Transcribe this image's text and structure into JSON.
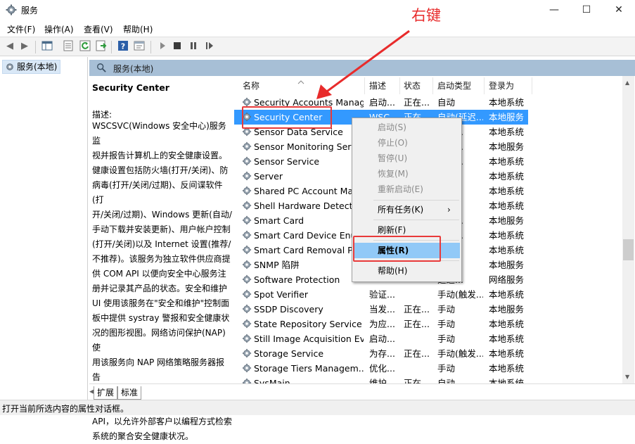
{
  "window": {
    "title": "服务",
    "buttons": {
      "minimize": "—",
      "maximize": "☐",
      "close": "✕"
    }
  },
  "menu": [
    "文件(F)",
    "操作(A)",
    "查看(V)",
    "帮助(H)"
  ],
  "tree": {
    "root": "服务(本地)"
  },
  "pane_header": "服务(本地)",
  "description": {
    "title": "Security Center",
    "label": "描述:",
    "text": "WSCSVC(Windows 安全中心)服务监视并报告计算机上的安全健康设置。健康设置包括防火墙(打开/关闭)、防病毒(打开/关闭/过期)、反间谍软件(打开/关闭/过期)、Windows 更新(自动/手动下载并安装更新)、用户帐户控制(打开/关闭)以及 Internet 设置(推荐/不推荐)。该服务为独立软件供应商提供 COM API 以便向安全中心服务注册并记录其产品的状态。安全和维护 UI 使用该服务在\"安全和维护\"控制面板中提供 systray 警报和安全健康状况的图形视图。网络访问保护(NAP)使用该服务向 NAP 网络策略服务器报告客户端的安全健康状况，以便进行网络隔离决策。该服务还提供一个公共 API，以允许外部客户以编程方式检索系统的聚合安全健康状况。",
    "lines": [
      "WSCSVC(Windows 安全中心)服务监",
      "视并报告计算机上的安全健康设置。",
      "健康设置包括防火墙(打开/关闭)、防",
      "病毒(打开/关闭/过期)、反间谍软件(打",
      "开/关闭/过期)、Windows 更新(自动/",
      "手动下载并安装更新)、用户帐户控制",
      "(打开/关闭)以及 Internet 设置(推荐/",
      "不推荐)。该服务为独立软件供应商提",
      "供 COM API 以便向安全中心服务注",
      "册并记录其产品的状态。安全和维护",
      "UI 使用该服务在\"安全和维护\"控制面",
      "板中提供 systray 警报和安全健康状",
      "况的图形视图。网络访问保护(NAP)使",
      "用该服务向 NAP 网络策略服务器报告",
      "客户端的安全健康状况，以便进行网",
      "络隔离决策。该服务还提供一个公共",
      "API，以允许外部客户以编程方式检索",
      "系统的聚合安全健康状况。"
    ]
  },
  "columns": [
    "名称",
    "描述",
    "状态",
    "启动类型",
    "登录为"
  ],
  "rows": [
    {
      "name": "Security Accounts Manag...",
      "desc": "启动...",
      "status": "正在...",
      "startup": "自动",
      "logon": "本地系统"
    },
    {
      "name": "Security Center",
      "desc": "WSC...",
      "status": "正在...",
      "startup": "自动(延迟...",
      "logon": "本地服务"
    },
    {
      "name": "Sensor Data Service",
      "desc": "",
      "status": "",
      "startup": "触发...",
      "logon": "本地系统"
    },
    {
      "name": "Sensor Monitoring Serv",
      "desc": "",
      "status": "",
      "startup": "触发...",
      "logon": "本地服务"
    },
    {
      "name": "Sensor Service",
      "desc": "",
      "status": "",
      "startup": "触发...",
      "logon": "本地系统"
    },
    {
      "name": "Server",
      "desc": "",
      "status": "",
      "startup": "",
      "logon": "本地系统"
    },
    {
      "name": "Shared PC Account Man",
      "desc": "",
      "status": "",
      "startup": "",
      "logon": "本地系统"
    },
    {
      "name": "Shell Hardware Detectio",
      "desc": "",
      "status": "",
      "startup": "",
      "logon": "本地系统"
    },
    {
      "name": "Smart Card",
      "desc": "",
      "status": "",
      "startup": "触发...",
      "logon": "本地服务"
    },
    {
      "name": "Smart Card Device Enun",
      "desc": "",
      "status": "",
      "startup": "触发...",
      "logon": "本地系统"
    },
    {
      "name": "Smart Card Removal Po",
      "desc": "",
      "status": "",
      "startup": "",
      "logon": "本地系统"
    },
    {
      "name": "SNMP 陷阱",
      "desc": "",
      "status": "",
      "startup": "",
      "logon": "本地服务"
    },
    {
      "name": "Software Protection",
      "desc": "",
      "status": "",
      "startup": "延迟...",
      "logon": "网络服务"
    },
    {
      "name": "Spot Verifier",
      "desc": "验证...",
      "status": "",
      "startup": "手动(触发...",
      "logon": "本地系统"
    },
    {
      "name": "SSDP Discovery",
      "desc": "当发...",
      "status": "正在...",
      "startup": "手动",
      "logon": "本地服务"
    },
    {
      "name": "State Repository Service",
      "desc": "为应...",
      "status": "正在...",
      "startup": "手动",
      "logon": "本地系统"
    },
    {
      "name": "Still Image Acquisition Ev...",
      "desc": "启动...",
      "status": "",
      "startup": "手动",
      "logon": "本地系统"
    },
    {
      "name": "Storage Service",
      "desc": "为存...",
      "status": "正在...",
      "startup": "手动(触发...",
      "logon": "本地系统"
    },
    {
      "name": "Storage Tiers Managem...",
      "desc": "优化...",
      "status": "",
      "startup": "手动",
      "logon": "本地系统"
    },
    {
      "name": "SysMain",
      "desc": "维护...",
      "status": "正在...",
      "startup": "自动",
      "logon": "本地系统"
    }
  ],
  "context_menu": {
    "items": [
      "启动(S)",
      "停止(O)",
      "暂停(U)",
      "恢复(M)",
      "重新启动(E)",
      "所有任务(K)",
      "刷新(F)",
      "属性(R)",
      "帮助(H)"
    ],
    "submenu_arrow": "›"
  },
  "tabs": [
    "扩展",
    "标准"
  ],
  "status": "打开当前所选内容的属性对话框。",
  "annotation": {
    "label": "右键",
    "color": "#e82b2b"
  }
}
